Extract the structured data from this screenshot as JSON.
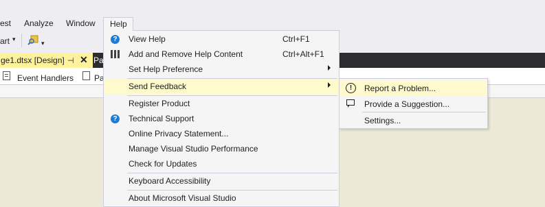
{
  "menubar": {
    "items": [
      "est",
      "Analyze",
      "Window"
    ],
    "help_label": "Help"
  },
  "toolbar": {
    "start_label": "art",
    "start_dropdown": "▾",
    "overflow": "▾"
  },
  "tabs": {
    "active_doc": "ge1.dtsx [Design]",
    "pin": "⊣",
    "close": "✕",
    "second_doc": "Pa"
  },
  "designer_tabs": {
    "event_handlers": "Event Handlers",
    "second": "Pa"
  },
  "help_menu": {
    "items": [
      {
        "label": "View Help",
        "shortcut": "Ctrl+F1",
        "icon": "help-circle-icon"
      },
      {
        "label": "Add and Remove Help Content",
        "shortcut": "Ctrl+Alt+F1",
        "icon": "books-icon"
      },
      {
        "label": "Set Help Preference",
        "shortcut": "",
        "has_submenu": true
      },
      {
        "label": "Send Feedback",
        "shortcut": "",
        "has_submenu": true,
        "highlighted": true
      },
      {
        "label": "Register Product"
      },
      {
        "label": "Technical Support",
        "icon": "help-circle-icon"
      },
      {
        "label": "Online Privacy Statement..."
      },
      {
        "label": "Manage Visual Studio Performance"
      },
      {
        "label": "Check for Updates"
      },
      {
        "label": "Keyboard Accessibility"
      },
      {
        "label": "About Microsoft Visual Studio"
      }
    ]
  },
  "feedback_submenu": {
    "items": [
      {
        "label": "Report a Problem...",
        "icon": "exclamation-circle-icon",
        "highlighted": true
      },
      {
        "label": "Provide a Suggestion...",
        "icon": "speech-bubble-icon"
      },
      {
        "label": "Settings..."
      }
    ]
  },
  "colors": {
    "menu_bg": "#f5f5f5",
    "highlight": "#fffacd",
    "active_tab": "#fff29d",
    "tabstrip": "#2d2d30",
    "canvas": "#ece9d8",
    "help_icon": "#1f7ad4"
  }
}
